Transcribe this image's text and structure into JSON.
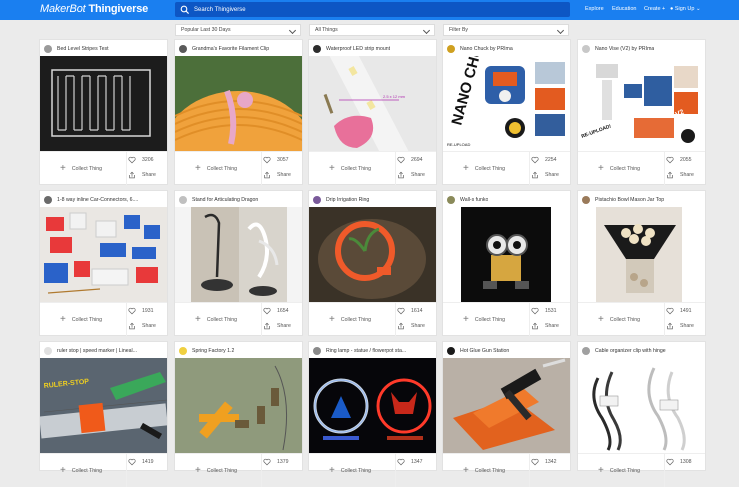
{
  "header": {
    "logo_prefix": "MakerBot",
    "logo_name": "Thingiverse",
    "search_placeholder": "Search Thingiverse",
    "nav": {
      "explore": "Explore",
      "education": "Education",
      "create": "Create",
      "signup": "Sign Up"
    }
  },
  "filters": {
    "sort": "Popular Last 30 Days",
    "category": "All Things",
    "filter": "Filter By"
  },
  "card_labels": {
    "collect": "Collect Thing",
    "share": "Share"
  },
  "cards": [
    {
      "title": "Bed Level Stripes Test",
      "likes": "3206"
    },
    {
      "title": "Grandma's Favorite Filament Clip",
      "likes": "3057"
    },
    {
      "title": "Waterproof LED strip mount",
      "likes": "2694"
    },
    {
      "title": "Nano Chuck by PRIma",
      "likes": "2254"
    },
    {
      "title": "Nano Vise (V2) by PRIma",
      "likes": "2055"
    },
    {
      "title": "1-8 way inline Car-Connectors, 6....",
      "likes": "1931"
    },
    {
      "title": "Stand for Articulating Dragon",
      "likes": "1654"
    },
    {
      "title": "Drip Irrigation Ring",
      "likes": "1614"
    },
    {
      "title": "Wall-s funko",
      "likes": "1531"
    },
    {
      "title": "Pistachio Bowl Mason Jar Top",
      "likes": "1491"
    },
    {
      "title": "ruler stop | speed marker | Lineal...",
      "likes": "1419"
    },
    {
      "title": "Spring Factory 1.2",
      "likes": "1379"
    },
    {
      "title": "Ring lamp - statue / flowerpot sta...",
      "likes": "1347"
    },
    {
      "title": "Hot Glue Gun Station",
      "likes": "1342"
    },
    {
      "title": "Cable organizer clip with hinge",
      "likes": "1308"
    }
  ],
  "thumb_text": {
    "led_dim": "2.5 x 12 mm",
    "nano_chuck": "NANO CHUCK",
    "reupload": "RE-UPLOAD",
    "nano_vise": "NANO VISE V2",
    "reupload2": "RE-UPLOAD!",
    "ruler_stop": "RULER-STOP"
  }
}
